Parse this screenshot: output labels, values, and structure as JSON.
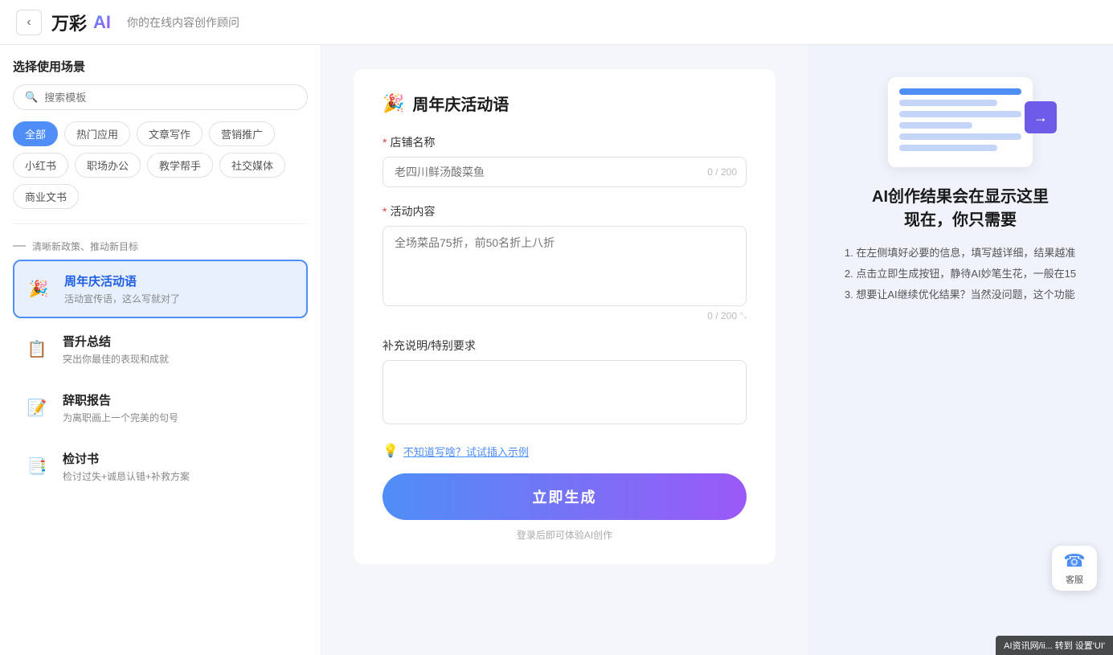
{
  "header": {
    "back_label": "‹",
    "logo_text": "万彩",
    "logo_ai": "AI",
    "subtitle": "你的在线内容创作顾问"
  },
  "sidebar": {
    "title": "选择使用场景",
    "search_placeholder": "搜索模板",
    "tags": [
      {
        "label": "全部",
        "active": true
      },
      {
        "label": "热门应用",
        "active": false
      },
      {
        "label": "文章写作",
        "active": false
      },
      {
        "label": "营销推广",
        "active": false
      },
      {
        "label": "小红书",
        "active": false
      },
      {
        "label": "职场办公",
        "active": false
      },
      {
        "label": "教学帮手",
        "active": false
      },
      {
        "label": "社交媒体",
        "active": false
      },
      {
        "label": "商业文书",
        "active": false
      }
    ],
    "promo_text": "清晰新政策、推动新目标",
    "items": [
      {
        "icon": "🎉",
        "title": "周年庆活动语",
        "desc": "活动宣传语，这么写就对了",
        "active": true
      },
      {
        "icon": "📋",
        "title": "晋升总结",
        "desc": "突出你最佳的表现和成就",
        "active": false
      },
      {
        "icon": "📝",
        "title": "辞职报告",
        "desc": "为离职画上一个完美的句号",
        "active": false
      },
      {
        "icon": "📑",
        "title": "检讨书",
        "desc": "检讨过失+诚恳认错+补救方案",
        "active": false
      }
    ]
  },
  "form": {
    "title": "周年庆活动语",
    "title_icon": "🎉",
    "shop_name_label": "店铺名称",
    "shop_name_placeholder": "老四川鲜汤酸菜鱼",
    "shop_name_count": "0 / 200",
    "activity_label": "活动内容",
    "activity_placeholder": "全场菜品75折，前50名折上八折",
    "activity_count": "0 / 200",
    "extra_label": "补充说明/特别要求",
    "extra_placeholder": "",
    "hint_text": "不知道写啥？试试插入示例",
    "generate_label": "立即生成",
    "generate_note": "登录后即可体验AI创作"
  },
  "right_panel": {
    "tip_title": "AI创作结果会在显示这里\n现在，你只需要",
    "tips": [
      "1. 在左侧填好必要的信息，填写越详细，结果越准",
      "2. 点击立即生成按钮，静待AI妙笔生花，一般在15",
      "3. 想要让AI继续优化结果？当然没问题，这个功能"
    ]
  },
  "cs": {
    "label": "客服"
  },
  "watermark": "AI资讯网/ii... 转到 设置'UI'"
}
